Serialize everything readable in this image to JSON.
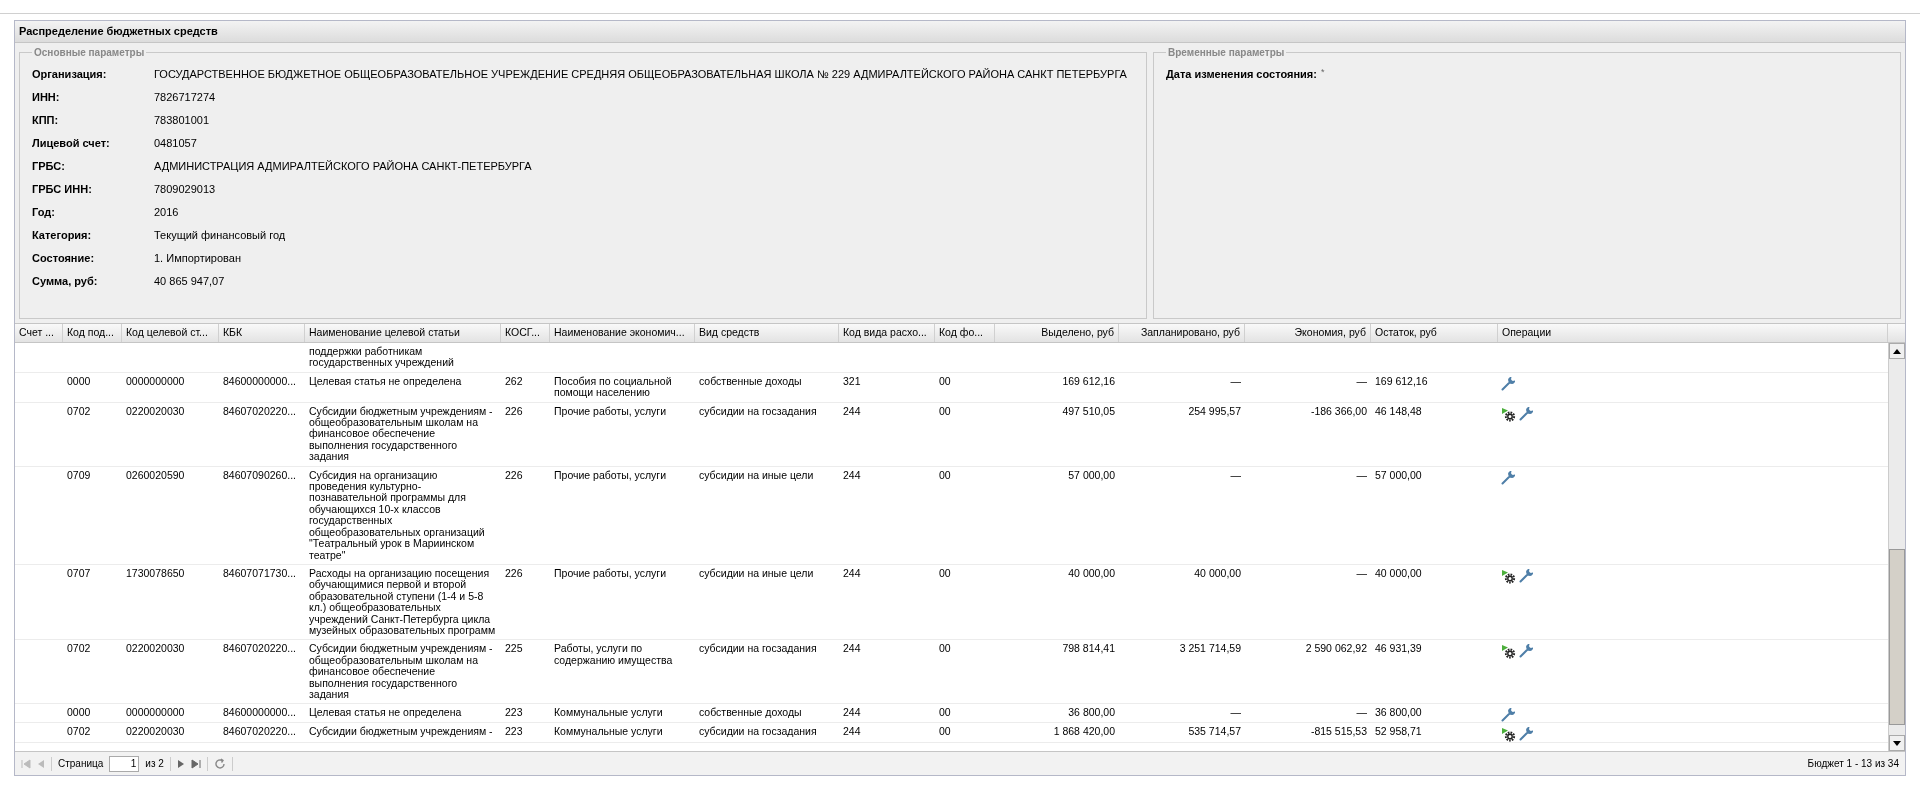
{
  "panel": {
    "title": "Распределение бюджетных средств"
  },
  "main_params": {
    "legend": "Основные параметры",
    "fields": [
      {
        "label": "Организация:",
        "value": "ГОСУДАРСТВЕННОЕ БЮДЖЕТНОЕ ОБЩЕОБРАЗОВАТЕЛЬНОЕ УЧРЕЖДЕНИЕ СРЕДНЯЯ ОБЩЕОБРАЗОВАТЕЛЬНАЯ ШКОЛА № 229 АДМИРАЛТЕЙСКОГО РАЙОНА САНКТ ПЕТЕРБУРГА"
      },
      {
        "label": "ИНН:",
        "value": "7826717274"
      },
      {
        "label": "КПП:",
        "value": "783801001"
      },
      {
        "label": "Лицевой счет:",
        "value": "0481057"
      },
      {
        "label": "ГРБС:",
        "value": "АДМИНИСТРАЦИЯ АДМИРАЛТЕЙСКОГО РАЙОНА САНКТ-ПЕТЕРБУРГА"
      },
      {
        "label": "ГРБС ИНН:",
        "value": "7809029013"
      },
      {
        "label": "Год:",
        "value": "2016"
      },
      {
        "label": "Категория:",
        "value": "Текущий финансовый год"
      },
      {
        "label": "Состояние:",
        "value": "1. Импортирован"
      },
      {
        "label": "Сумма, руб:",
        "value": "40 865 947,07"
      }
    ]
  },
  "time_params": {
    "legend": "Временные параметры",
    "fields": [
      {
        "label": "Дата изменения состояния:",
        "value": "*"
      }
    ]
  },
  "table": {
    "columns": [
      "Счет ...",
      "Код под...",
      "Код целевой ст...",
      "КБК",
      "Наименование целевой статьи",
      "КОСГ...",
      "Наименование экономич...",
      "Вид средств",
      "Код вида расхо...",
      "Код фо...",
      "Выделено, руб",
      "Запланировано, руб",
      "Экономия, руб",
      "Остаток, руб",
      "Операции"
    ],
    "rows": [
      {
        "target_name": "поддержки работникам государственных учреждений",
        "process_action": false,
        "edit_action": false
      },
      {
        "section": "0000",
        "target_code": "0000000000",
        "kbk": "84600000000...",
        "target_name": "Целевая статья не определена",
        "kosgu": "262",
        "econ_name": "Пособия по социальной помощи населению",
        "funds": "собственные доходы",
        "expense_code": "321",
        "fund_code": "00",
        "allocated": "169 612,16",
        "planned": "—",
        "savings": "—",
        "remainder": "169 612,16",
        "process_action": false,
        "edit_action": true
      },
      {
        "section": "0702",
        "target_code": "0220020030",
        "kbk": "84607020220...",
        "target_name": "Субсидии бюджетным учреждениям - общеобразовательным школам на финансовое обеспечение выполнения государственного задания",
        "kosgu": "226",
        "econ_name": "Прочие работы, услуги",
        "funds": "субсидии на госзадания",
        "expense_code": "244",
        "fund_code": "00",
        "allocated": "497 510,05",
        "planned": "254 995,57",
        "savings": "-186 366,00",
        "remainder": "46 148,48",
        "process_action": true,
        "edit_action": true
      },
      {
        "section": "0709",
        "target_code": "0260020590",
        "kbk": "84607090260...",
        "target_name": "Субсидия на организацию проведения культурно-познавательной программы для обучающихся 10-х классов государственных общеобразовательных организаций \"Театральный урок в Мариинском театре\"",
        "kosgu": "226",
        "econ_name": "Прочие работы, услуги",
        "funds": "субсидии на иные цели",
        "expense_code": "244",
        "fund_code": "00",
        "allocated": "57 000,00",
        "planned": "—",
        "savings": "—",
        "remainder": "57 000,00",
        "process_action": false,
        "edit_action": true
      },
      {
        "section": "0707",
        "target_code": "1730078650",
        "kbk": "84607071730...",
        "target_name": "Расходы на организацию посещения обучающимися первой и второй образовательной ступени (1-4 и 5-8 кл.) общеобразовательных учреждений Санкт-Петербурга цикла музейных образовательных программ",
        "kosgu": "226",
        "econ_name": "Прочие работы, услуги",
        "funds": "субсидии на иные цели",
        "expense_code": "244",
        "fund_code": "00",
        "allocated": "40 000,00",
        "planned": "40 000,00",
        "savings": "—",
        "remainder": "40 000,00",
        "process_action": true,
        "edit_action": true
      },
      {
        "section": "0702",
        "target_code": "0220020030",
        "kbk": "84607020220...",
        "target_name": "Субсидии бюджетным учреждениям - общеобразовательным школам на финансовое обеспечение выполнения государственного задания",
        "kosgu": "225",
        "econ_name": "Работы, услуги по содержанию имущества",
        "funds": "субсидии на госзадания",
        "expense_code": "244",
        "fund_code": "00",
        "allocated": "798 814,41",
        "planned": "3 251 714,59",
        "savings": "2 590 062,92",
        "remainder": "46 931,39",
        "process_action": true,
        "edit_action": true
      },
      {
        "section": "0000",
        "target_code": "0000000000",
        "kbk": "84600000000...",
        "target_name": "Целевая статья не определена",
        "kosgu": "223",
        "econ_name": "Коммунальные услуги",
        "funds": "собственные доходы",
        "expense_code": "244",
        "fund_code": "00",
        "allocated": "36 800,00",
        "planned": "—",
        "savings": "—",
        "remainder": "36 800,00",
        "process_action": false,
        "edit_action": true
      },
      {
        "section": "0702",
        "target_code": "0220020030",
        "kbk": "84607020220...",
        "target_name": "Субсидии бюджетным учреждениям -",
        "kosgu": "223",
        "econ_name": "Коммунальные услуги",
        "funds": "субсидии на госзадания",
        "expense_code": "244",
        "fund_code": "00",
        "allocated": "1 868 420,00",
        "planned": "535 714,57",
        "savings": "-815 515,53",
        "remainder": "52 958,71",
        "process_action": true,
        "edit_action": true
      }
    ]
  },
  "pager": {
    "page_label": "Страница",
    "page": "1",
    "of_pages": "из 2",
    "summary": "Бюджет 1 - 13 из 34"
  }
}
